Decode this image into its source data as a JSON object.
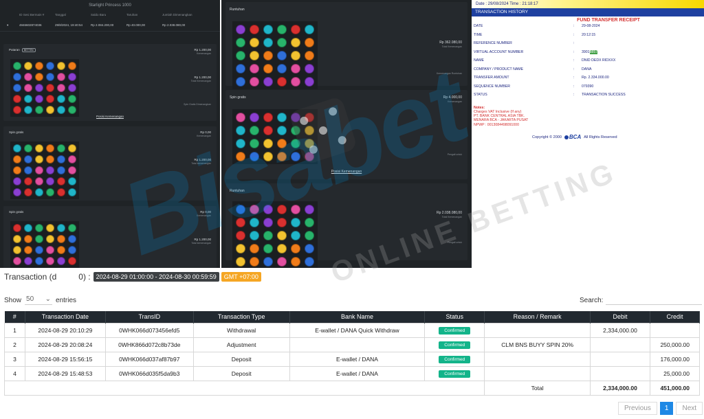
{
  "game_left": {
    "title": "Starlight Princess 1000",
    "headers": [
      "ID Sesi Bermain #",
      "Tanggal",
      "Saldo Baru",
      "Taruhan",
      "Jumlah Dimenangkan"
    ],
    "row": [
      "4846602874036",
      "29/8/2024, 19:40:54",
      "Rp 2.084.200,00",
      "Rp 40.000,00",
      "Rp 2.038.080,00"
    ],
    "sections": [
      {
        "label": "Putaran",
        "badge": "BETTEN",
        "r1": "Rp 1.200,00",
        "r1_sub": "Kemenangan",
        "r2": "Rp 1.200,00",
        "r2_sub": "Total Kemenangan",
        "note": "Spin Gratis Dimenangkan",
        "link": "Posisi Kemenangan"
      },
      {
        "label": "Spin gratis",
        "r1": "Rp 0,00",
        "r1_sub": "Kemenangan",
        "r2": "Rp 1.200,00",
        "r2_sub": "Total kemenangan"
      },
      {
        "label": "Spin gratis",
        "r1": "Rp 0,00",
        "r1_sub": "Kemenangan",
        "r2": "Rp 1.200,00",
        "r2_sub": "Total kemenangan"
      }
    ]
  },
  "game_mid": {
    "sections": [
      {
        "label": "Runtuhan",
        "r1": "Rp 362.080,00",
        "r1_sub": "Total Kemenangan",
        "note": "Kemenangan Runtuhan"
      },
      {
        "label": "Spin gratis",
        "r1": "Rp 4.000,00",
        "r1_sub": "Kemenangan",
        "note": "Pengali untuk",
        "link": "Posisi Kemenangan"
      },
      {
        "label": "Runtuhan",
        "r1": "Rp 2.038.080,00",
        "r1_sub": "Total Kemenangan",
        "note": "Pengali untuk"
      }
    ]
  },
  "receipt": {
    "datebar": "Date : 29/08/2024 Time : 21:18:17",
    "header": "TRANSACTION HISTORY",
    "title": "FUND TRANSFER RECEIPT",
    "rows": [
      {
        "k": "DATE",
        "c": ":",
        "v": "29-08-2024"
      },
      {
        "k": "TIME",
        "c": ":",
        "v": "20:12:15"
      },
      {
        "k": "REFERENCE NUMBER",
        "c": ":",
        "v": ""
      },
      {
        "k": "VIRTUAL ACCOUNT NUMBER",
        "c": ":",
        "v": "3901",
        "v_hl": "8857"
      },
      {
        "k": "NAME",
        "c": ":",
        "v": "DNID DEDX RIDXXX"
      },
      {
        "k": "COMPANY / PRODUCT NAME",
        "c": ":",
        "v": "DANA"
      },
      {
        "k": "TRANSFER AMOUNT",
        "c": ":",
        "v": "Rp. 2.334.000.00"
      },
      {
        "k": "SEQUENCE NUMBER",
        "c": ":",
        "v": "079390"
      },
      {
        "k": "STATUS",
        "c": ":",
        "v": "TRANSACTION SUCCESS"
      }
    ],
    "notes_title": "Notes:",
    "notes": [
      "Charges VAT Inclusive (If any)",
      "PT. BANK CENTRAL ASIA TBK.",
      "MENARA BCA - JAKARTA PUSAT",
      "NPWP : 0013084498091000"
    ],
    "copyright_pre": "Copyright © 2000",
    "bca": "BCA",
    "copyright_post": "All Rights Reserved"
  },
  "watermark": {
    "brand": "Bisabet",
    "sub": "ONLINE BETTING"
  },
  "transactions": {
    "label_pre": "Transaction (d",
    "label_post": "0) :",
    "range": "2024-08-29 01:00:00 - 2024-08-30 00:59:59",
    "gmt": "GMT +07:00",
    "show_label": "Show",
    "show_value": "50",
    "entries_label": "entries",
    "search_label": "Search:",
    "columns": [
      "#",
      "Transaction Date",
      "TransID",
      "Transaction Type",
      "Bank Name",
      "Status",
      "Reason / Remark",
      "Debit",
      "Credit"
    ],
    "rows": [
      {
        "n": "1",
        "date": "2024-08-29 20:10:29",
        "id": "0WHK066d073456efd5",
        "type": "Withdrawal",
        "bank": "E-wallet / DANA Quick Withdraw",
        "status": "Confirmed",
        "remark": "",
        "debit": "2,334,000.00",
        "credit": ""
      },
      {
        "n": "2",
        "date": "2024-08-29 20:08:24",
        "id": "0WHK866d072c8b73de",
        "type": "Adjustment",
        "bank": "",
        "status": "Confirmed",
        "remark": "CLM BNS BUYY SPIN 20%",
        "debit": "",
        "credit": "250,000.00"
      },
      {
        "n": "3",
        "date": "2024-08-29 15:56:15",
        "id": "0WHK066d037af87b97",
        "type": "Deposit",
        "bank": "E-wallet / DANA",
        "status": "Confirmed",
        "remark": "",
        "debit": "",
        "credit": "176,000.00"
      },
      {
        "n": "4",
        "date": "2024-08-29 15:48:53",
        "id": "0WHK066d035f5da9b3",
        "type": "Deposit",
        "bank": "E-wallet / DANA",
        "status": "Confirmed",
        "remark": "",
        "debit": "",
        "credit": "25,000.00"
      }
    ],
    "total_label": "Total",
    "total_debit": "2,334,000.00",
    "total_credit": "451,000.00"
  },
  "pager": {
    "prev": "Previous",
    "page": "1",
    "next": "Next"
  },
  "colors": {
    "header": "#222930",
    "status": "#13b48a",
    "receipt_blue": "#1e40a0",
    "gmt": "#f5a623"
  }
}
